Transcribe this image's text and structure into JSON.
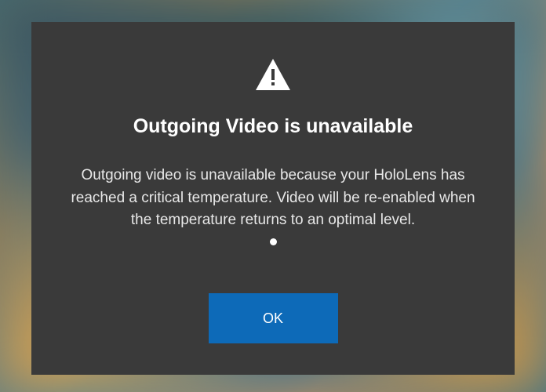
{
  "dialog": {
    "icon": "warning-triangle",
    "title": "Outgoing Video is unavailable",
    "message": "Outgoing video is unavailable because your HoloLens has reached a critical temperature. Video will be re-enabled when the temperature returns to an optimal level.",
    "ok_label": "OK"
  },
  "colors": {
    "dialog_bg": "#3a3a3a",
    "button_bg": "#0d6ab8",
    "text": "#ffffff"
  }
}
